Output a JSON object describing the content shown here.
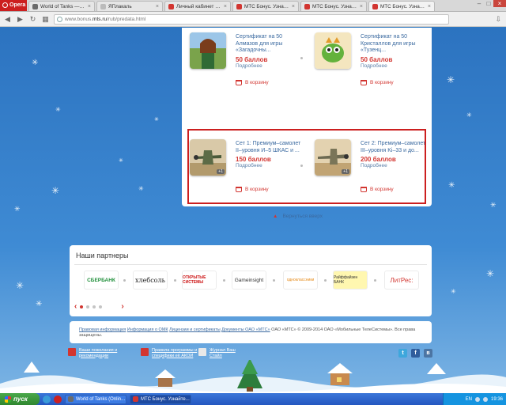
{
  "browser": {
    "menu_label": "Opera",
    "tabs": [
      {
        "label": "World of Tanks — бес",
        "color": "#6b6b6b",
        "active": false
      },
      {
        "label": "ЯПлакаль",
        "color": "#999999",
        "active": false
      },
      {
        "label": "Личный кабинет МТС",
        "color": "#d23530",
        "active": false
      },
      {
        "label": "МТС Бонус. Узнайте,",
        "color": "#d23530",
        "active": false
      },
      {
        "label": "МТС Бонус. Узнайте,",
        "color": "#d23530",
        "active": false
      },
      {
        "label": "МТС Бонус. Узнайте, к",
        "color": "#d23530",
        "active": true
      }
    ],
    "url_prefix": "www.bonus.",
    "url_domain": "mts.ru",
    "url_path": "/rub/predata.html"
  },
  "products": [
    {
      "title": "Сертификат на 50 Алмазов для игры «Загадочны...",
      "price": "50 баллов",
      "more": "Подробнее",
      "cart": "В корзину"
    },
    {
      "title": "Сертификат на 50 Кристаллов для игры «Тузенц...",
      "price": "50 баллов",
      "more": "Подробнее",
      "cart": "В корзину"
    },
    {
      "title": "Сет 1: Премиум–самолет II–уровня И–5 ШКАС и ...",
      "price": "150 баллов",
      "more": "Подробнее",
      "cart": "В корзину",
      "badge": "+1"
    },
    {
      "title": "Сет 2: Премиум–самолет III–уровня Ki–33 и до...",
      "price": "200 баллов",
      "more": "Подробнее",
      "cart": "В корзину",
      "badge": "+1"
    }
  ],
  "back_to_top": "Вернуться вверх",
  "partners": {
    "title": "Наши партнеры",
    "logos": [
      "СБЕРБАНК",
      "хлебсоль",
      "ОТКРЫТЫЕ СИСТЕМЫ",
      "Gameinsight",
      "одноклассники",
      "Райффайзен БАНК",
      "ЛитРес:"
    ]
  },
  "footer": {
    "links": [
      "Правовая информация",
      "Информация о ОМК",
      "Лицензии и сертификаты",
      "Документы ОАО «МТС»"
    ],
    "copyright": "ОАО «МТС» © 2009-2014 ОАО «Мобильные ТелеСистемы». Все права защищены.",
    "bottom_links": [
      {
        "label": "Ваши пожелания и рекомендации",
        "icon": "mail-icon"
      },
      {
        "label": "Правила программы и специфики её АКОИ",
        "icon": "document-icon"
      },
      {
        "label": "Журнал Ваш Стайл",
        "icon": "magazine-icon"
      }
    ]
  },
  "taskbar": {
    "start_label": "пуск",
    "tasks": [
      {
        "label": "World of Tanks (Onlin...",
        "active": false
      },
      {
        "label": "МТС Бонус. Узнайте...",
        "active": true
      }
    ],
    "lang": "EN",
    "clock": "19:36"
  },
  "colors": {
    "accent_red": "#d23530",
    "link_blue": "#3b6aa0",
    "sky_blue": "#2c73c0"
  }
}
